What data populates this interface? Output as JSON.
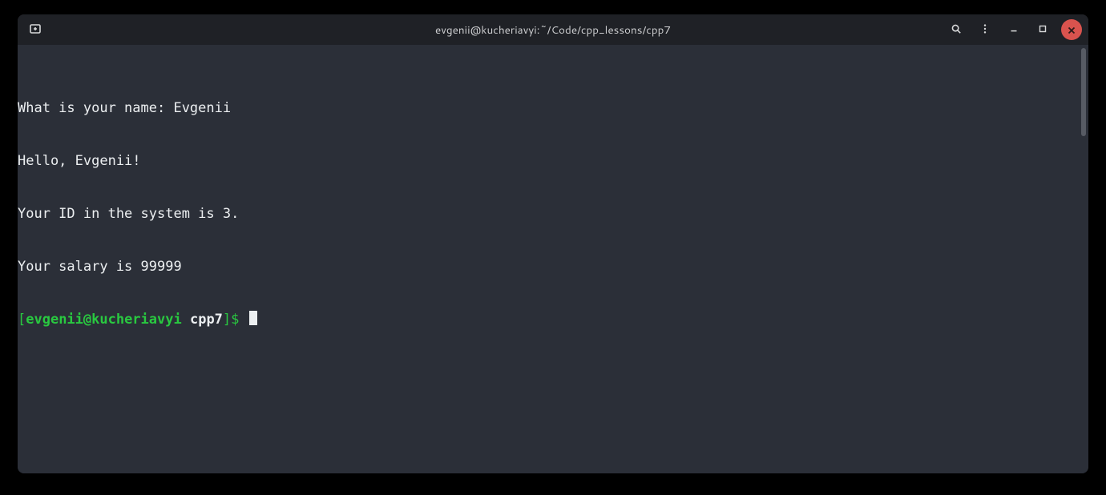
{
  "titlebar": {
    "title": "evgenii@kucheriavyi:~/Code/cpp_lessons/cpp7"
  },
  "terminal": {
    "lines": [
      "What is your name: Evgenii",
      "Hello, Evgenii!",
      "Your ID in the system is 3.",
      "Your salary is 99999"
    ],
    "prompt": {
      "open_bracket": "[",
      "user_host": "evgenii@kucheriavyi",
      "space": " ",
      "dir": "cpp7",
      "close": "]$"
    }
  }
}
